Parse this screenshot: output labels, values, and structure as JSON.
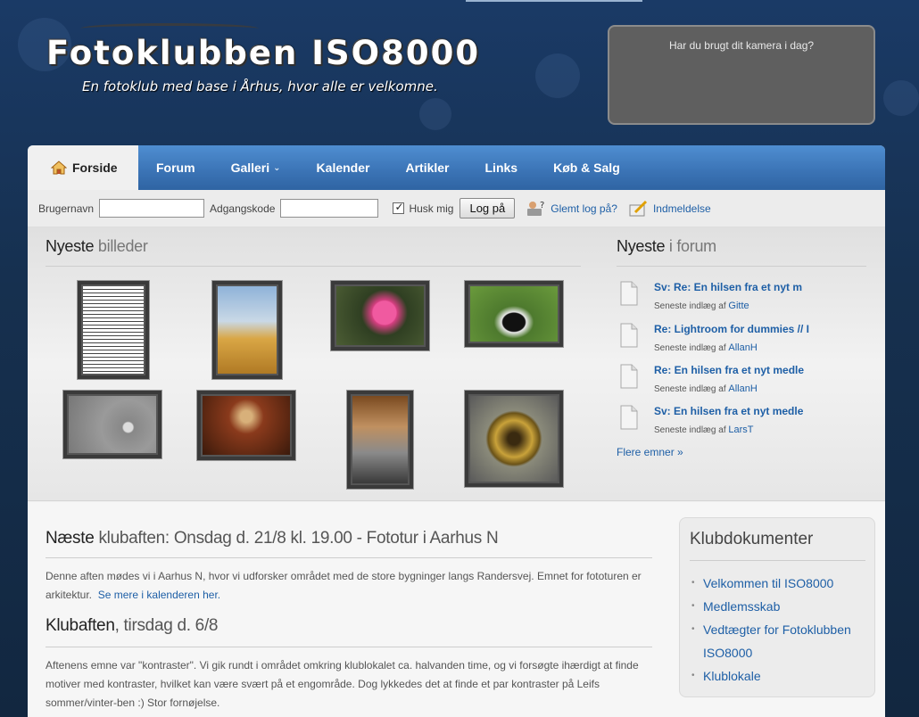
{
  "header": {
    "title": "Fotoklubben ISO8000",
    "subtitle": "En fotoklub med base i Århus, hvor alle er velkomne.",
    "box_text": "Har du brugt dit kamera i dag?"
  },
  "nav": {
    "items": [
      {
        "label": "Forside",
        "icon": "home-icon",
        "active": true
      },
      {
        "label": "Forum"
      },
      {
        "label": "Galleri",
        "has_dropdown": true
      },
      {
        "label": "Kalender"
      },
      {
        "label": "Artikler"
      },
      {
        "label": "Links"
      },
      {
        "label": "Køb & Salg"
      }
    ]
  },
  "login": {
    "username_label": "Brugernavn",
    "username_value": "",
    "password_label": "Adgangskode",
    "password_value": "",
    "remember_label": "Husk mig",
    "remember_checked": true,
    "login_button": "Log på",
    "forgot_label": "Glemt log på?",
    "register_label": "Indmeldelse"
  },
  "featured": {
    "images_heading_strong": "Nyeste",
    "images_heading_light": " billeder",
    "forum_heading_strong": "Nyeste",
    "forum_heading_light": " i forum",
    "forum_posts": [
      {
        "title": "Sv: Re: En hilsen fra et nyt m",
        "meta": "Seneste indlæg af",
        "author": "Gitte"
      },
      {
        "title": "Re: Lightroom for dummies // I",
        "meta": "Seneste indlæg af",
        "author": "AllanH"
      },
      {
        "title": "Re: En hilsen fra et nyt medle",
        "meta": "Seneste indlæg af",
        "author": "AllanH"
      },
      {
        "title": "Sv: En hilsen fra et nyt medle",
        "meta": "Seneste indlæg af",
        "author": "LarsT"
      }
    ],
    "more_link": "Flere emner »"
  },
  "articles": [
    {
      "heading_strong": "Næste",
      "heading_light": " klubaften: Onsdag d. 21/8 kl. 19.00 - Fototur i Aarhus N",
      "body": "Denne aften mødes vi i Aarhus N, hvor vi udforsker området med de store bygninger langs Randersvej. Emnet for fototuren er arkitektur.",
      "link": "Se mere i kalenderen her."
    },
    {
      "heading_strong": "Klubaften",
      "heading_light": ", tirsdag d. 6/8",
      "body": "Aftenens emne var \"kontraster\". Vi gik rundt i området omkring klublokalet ca. halvanden time, og vi forsøgte ihærdigt at finde motiver med kontraster, hvilket kan være svært på et engområde. Dog lykkedes det at finde et par kontraster på Leifs sommer/vinter-ben :) Stor fornøjelse."
    }
  ],
  "sidebar": {
    "title": "Klubdokumenter",
    "items": [
      "Velkommen til ISO8000",
      "Medlemsskab",
      "Vedtægter for Fotoklubben ISO8000",
      "Klublokale"
    ]
  },
  "colors": {
    "nav_blue": "#3c75b7",
    "link_blue": "#1e5fa6",
    "background": "#16304f"
  }
}
